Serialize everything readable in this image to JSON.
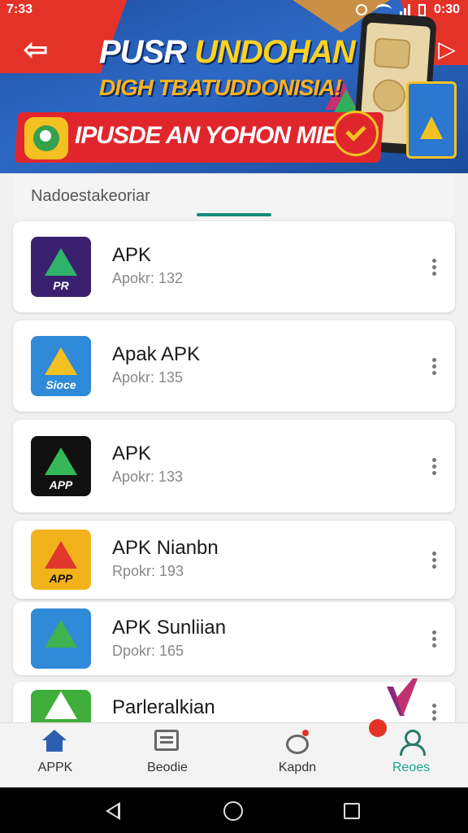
{
  "status_bar": {
    "time": "7:33",
    "clock_right": "0:30"
  },
  "banner": {
    "headline_white": "PUSR",
    "headline_yellow": "UNDOHAN",
    "subline": "DIGH TBATUDDONISIA!",
    "promo_text": "IPUSDE AN YOHON MIEUR!"
  },
  "tab": {
    "label": "Nadoestakeoriar"
  },
  "apps": [
    {
      "name": "APK",
      "meta": "Apokr: 132",
      "icon": "apk-triangle-purple-icon",
      "icon_text": "PR",
      "bg": "#3a2170",
      "accent": "#2fb36a"
    },
    {
      "name": "Apak APK",
      "meta": "Apokr: 135",
      "icon": "apk-google-style-icon",
      "icon_text": "Sioce",
      "bg": "#2f8ad8",
      "accent": "#f3c222"
    },
    {
      "name": "APK",
      "meta": "Apokr: 133",
      "icon": "apk-a-black-icon",
      "icon_text": "APP",
      "bg": "#111111",
      "accent": "#35b85a"
    },
    {
      "name": "APK Nianbn",
      "meta": "Rpokr: 193",
      "icon": "apk-orange-arrow-icon",
      "icon_text": "APP",
      "bg": "#f2b21c",
      "accent": "#e0392b"
    },
    {
      "name": "APK Sunliian",
      "meta": "Dpokr: 165",
      "icon": "apk-blue-arrow-icon",
      "icon_text": "",
      "bg": "#2f8ad8",
      "accent": "#3fb34f"
    },
    {
      "name": "Parleralkian",
      "meta": "",
      "icon": "apk-green-cart-icon",
      "icon_text": "",
      "bg": "#3fae3a",
      "accent": "#ffffff"
    }
  ],
  "bottom_nav": [
    {
      "label": "APPK",
      "icon": "home-icon",
      "active": false
    },
    {
      "label": "Beodie",
      "icon": "news-icon",
      "active": false
    },
    {
      "label": "Kapdn",
      "icon": "notification-icon",
      "active": false
    },
    {
      "label": "Reoes",
      "icon": "profile-icon",
      "active": true
    }
  ],
  "colors": {
    "accent": "#158b78",
    "active_label": "#17a58d",
    "banner_blue": "#1f4fa3",
    "banner_red": "#e53228"
  }
}
